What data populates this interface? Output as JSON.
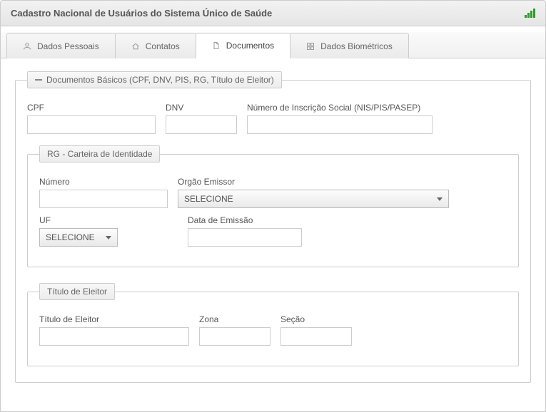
{
  "header": {
    "title": "Cadastro Nacional de Usuários do Sistema Único de Saúde"
  },
  "tabs": {
    "pessoais": {
      "label": "Dados Pessoais"
    },
    "contatos": {
      "label": "Contatos"
    },
    "documentos": {
      "label": "Documentos"
    },
    "biometricos": {
      "label": "Dados Biométricos"
    }
  },
  "groups": {
    "basicos": {
      "legend": "Documentos Básicos (CPF, DNV, PIS, RG, Título de Eleitor)",
      "cpf": {
        "label": "CPF",
        "value": ""
      },
      "dnv": {
        "label": "DNV",
        "value": ""
      },
      "nis": {
        "label": "Número de Inscrição Social (NIS/PIS/PASEP)",
        "value": ""
      }
    },
    "rg": {
      "legend": "RG - Carteira de Identidade",
      "numero": {
        "label": "Número",
        "value": ""
      },
      "orgao": {
        "label": "Orgão Emissor",
        "selected": "SELECIONE"
      },
      "uf": {
        "label": "UF",
        "selected": "SELECIONE"
      },
      "emissao": {
        "label": "Data de Emissão",
        "value": ""
      }
    },
    "titulo": {
      "legend": "Título de Eleitor",
      "titulo": {
        "label": "Título de Eleitor",
        "value": ""
      },
      "zona": {
        "label": "Zona",
        "value": ""
      },
      "secao": {
        "label": "Seção",
        "value": ""
      }
    }
  }
}
